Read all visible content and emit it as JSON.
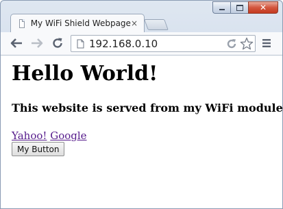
{
  "browser": {
    "tab_title": "My WiFi Shield Webpage",
    "tab_close": "×",
    "url": "192.168.0.10"
  },
  "page": {
    "heading": "Hello World!",
    "subheading": "This website is served from my WiFi module",
    "links": [
      "Yahoo!",
      "Google"
    ],
    "button_label": "My Button"
  },
  "colors": {
    "visited_link": "#551a8b",
    "close_button": "#c43a1f"
  }
}
